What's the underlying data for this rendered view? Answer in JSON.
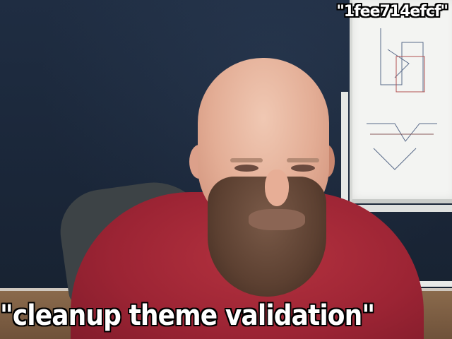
{
  "captions": {
    "top": "\"1fee714efcf\"",
    "bottom": "\"cleanup theme validation\""
  },
  "colors": {
    "wall": "#1f2d42",
    "shirt": "#9c2434",
    "whiteboard": "#f3f4f2",
    "floor": "#8a6a4c",
    "caption_text": "#ffffff",
    "caption_outline": "#000000"
  }
}
